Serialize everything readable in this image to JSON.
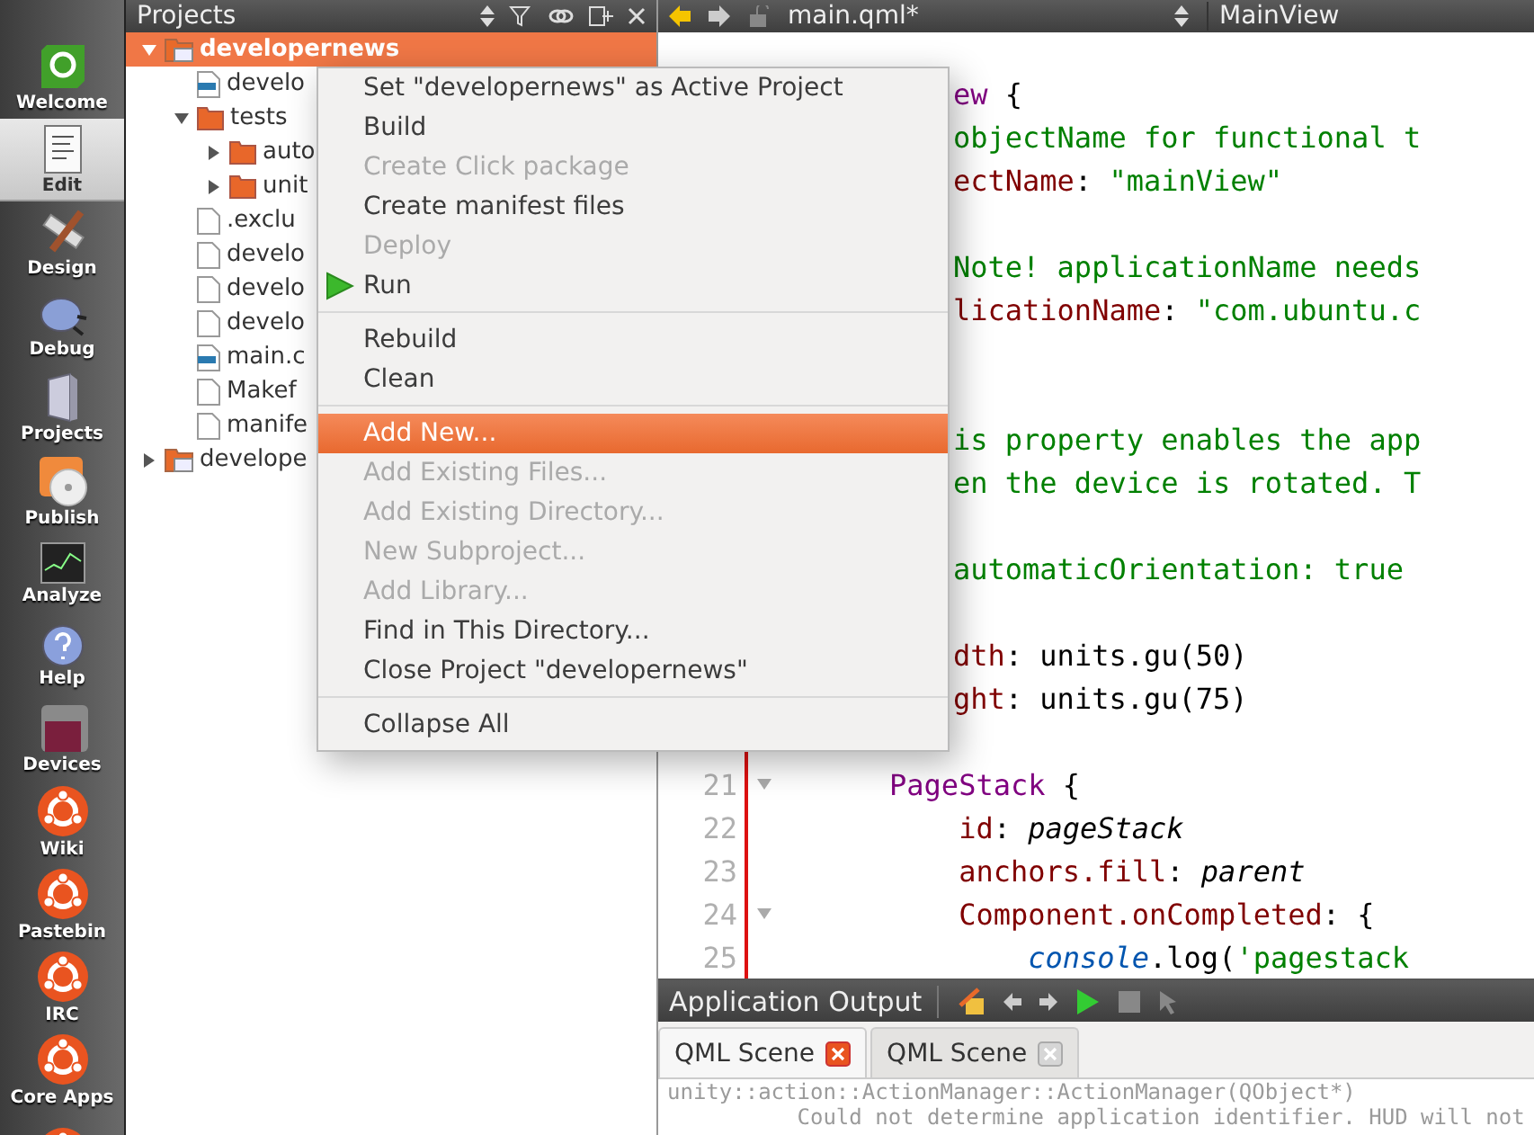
{
  "sidebar": {
    "items": [
      {
        "kind": "qt",
        "label": "Welcome",
        "selected": false
      },
      {
        "kind": "edit",
        "label": "Edit",
        "selected": true
      },
      {
        "kind": "design",
        "label": "Design",
        "selected": false
      },
      {
        "kind": "debug",
        "label": "Debug",
        "selected": false
      },
      {
        "kind": "projects",
        "label": "Projects",
        "selected": false
      },
      {
        "kind": "publish",
        "label": "Publish",
        "selected": false
      },
      {
        "kind": "analyze",
        "label": "Analyze",
        "selected": false
      },
      {
        "kind": "help",
        "label": "Help",
        "selected": false
      },
      {
        "kind": "devices",
        "label": "Devices",
        "selected": false
      },
      {
        "kind": "ubuntu",
        "label": "Wiki",
        "selected": false
      },
      {
        "kind": "ubuntu",
        "label": "Pastebin",
        "selected": false
      },
      {
        "kind": "ubuntu",
        "label": "IRC",
        "selected": false
      },
      {
        "kind": "ubuntu",
        "label": "Core Apps",
        "selected": false
      },
      {
        "kind": "ubuntu",
        "selected": false
      }
    ]
  },
  "projects_panel": {
    "title": "Projects",
    "tree": [
      {
        "kind": "project",
        "label": "developernews",
        "selected": true,
        "expanded": true,
        "children": [
          {
            "kind": "qml",
            "label": "develo",
            "selected": false
          },
          {
            "kind": "folder",
            "label": "tests",
            "selected": false,
            "expanded": true,
            "children": [
              {
                "kind": "folder",
                "label": "auto",
                "selected": false,
                "expanded": false
              },
              {
                "kind": "folder",
                "label": "unit",
                "selected": false,
                "expanded": false
              }
            ]
          },
          {
            "kind": "file",
            "label": ".exclu",
            "selected": false
          },
          {
            "kind": "file",
            "label": "develo",
            "selected": false
          },
          {
            "kind": "file",
            "label": "develo",
            "selected": false
          },
          {
            "kind": "file",
            "label": "develo",
            "selected": false
          },
          {
            "kind": "qml",
            "label": "main.c",
            "selected": false
          },
          {
            "kind": "file",
            "label": "Makef",
            "selected": false
          },
          {
            "kind": "file",
            "label": "manife",
            "selected": false
          }
        ]
      },
      {
        "kind": "project",
        "label": "develope",
        "selected": false,
        "expanded": false
      }
    ]
  },
  "editor": {
    "file": "main.qml*",
    "symbol": "MainView",
    "lines": [
      {
        "kind": "code",
        "tokens": [
          {
            "kind": "keyword",
            "text": "ew"
          },
          {
            "kind": "plain",
            "text": " {"
          }
        ]
      },
      {
        "kind": "code",
        "tokens": [
          {
            "kind": "comment",
            "text": "objectName for functional t"
          }
        ]
      },
      {
        "kind": "code",
        "tokens": [
          {
            "kind": "property",
            "text": "ectName"
          },
          {
            "kind": "plain",
            "text": ": "
          },
          {
            "kind": "string",
            "text": "\"mainView\""
          }
        ]
      },
      {
        "kind": "blank"
      },
      {
        "kind": "code",
        "tokens": [
          {
            "kind": "comment",
            "text": "Note! applicationName needs"
          }
        ]
      },
      {
        "kind": "code",
        "tokens": [
          {
            "kind": "property",
            "text": "licationName"
          },
          {
            "kind": "plain",
            "text": ": "
          },
          {
            "kind": "string",
            "text": "\"com.ubuntu.c"
          }
        ]
      },
      {
        "kind": "blank"
      },
      {
        "kind": "blank"
      },
      {
        "kind": "code",
        "tokens": [
          {
            "kind": "comment",
            "text": "is property enables the app"
          }
        ]
      },
      {
        "kind": "code",
        "tokens": [
          {
            "kind": "comment",
            "text": "en the device is rotated. T"
          }
        ]
      },
      {
        "kind": "blank"
      },
      {
        "kind": "code",
        "tokens": [
          {
            "kind": "comment",
            "text": "automaticOrientation: true"
          }
        ]
      },
      {
        "kind": "blank"
      },
      {
        "kind": "code",
        "tokens": [
          {
            "kind": "property",
            "text": "dth"
          },
          {
            "kind": "plain",
            "text": ": units.gu(50)"
          }
        ]
      },
      {
        "kind": "code",
        "tokens": [
          {
            "kind": "property",
            "text": "ght"
          },
          {
            "kind": "plain",
            "text": ": units.gu(75)"
          }
        ]
      },
      {
        "kind": "blank"
      },
      {
        "kind": "code",
        "number": "21",
        "foldable": true,
        "tokens": [
          {
            "kind": "keyword",
            "text": "    PageStack"
          },
          {
            "kind": "plain",
            "text": " {"
          }
        ]
      },
      {
        "kind": "code",
        "number": "22",
        "foldable": false,
        "tokens": [
          {
            "kind": "property",
            "text": "        id"
          },
          {
            "kind": "plain",
            "text": ": "
          },
          {
            "kind": "italic",
            "text": "pageStack"
          }
        ]
      },
      {
        "kind": "code",
        "number": "23",
        "foldable": false,
        "tokens": [
          {
            "kind": "property",
            "text": "        anchors.fill"
          },
          {
            "kind": "plain",
            "text": ": "
          },
          {
            "kind": "italic",
            "text": "parent"
          }
        ]
      },
      {
        "kind": "code",
        "number": "24",
        "foldable": true,
        "tokens": [
          {
            "kind": "property",
            "text": "        Component.onCompleted"
          },
          {
            "kind": "plain",
            "text": ": {"
          }
        ]
      },
      {
        "kind": "code",
        "number": "25",
        "foldable": false,
        "tokens": [
          {
            "kind": "builtin",
            "text": "            console"
          },
          {
            "kind": "plain",
            "text": ".log("
          },
          {
            "kind": "string",
            "text": "'pagestack"
          }
        ]
      }
    ]
  },
  "context_menu": [
    {
      "kind": "item",
      "label": "Set \"developernews\" as Active Project",
      "disabled": false,
      "selected": false
    },
    {
      "kind": "item",
      "label": "Build",
      "disabled": false,
      "selected": false
    },
    {
      "kind": "item",
      "label": "Create Click package",
      "disabled": true,
      "selected": false
    },
    {
      "kind": "item",
      "label": "Create manifest files",
      "disabled": false,
      "selected": false
    },
    {
      "kind": "item",
      "label": "Deploy",
      "disabled": true,
      "selected": false
    },
    {
      "kind": "run",
      "label": "Run",
      "disabled": false,
      "selected": false
    },
    {
      "kind": "separator"
    },
    {
      "kind": "item",
      "label": "Rebuild",
      "disabled": false,
      "selected": false
    },
    {
      "kind": "item",
      "label": "Clean",
      "disabled": false,
      "selected": false
    },
    {
      "kind": "separator"
    },
    {
      "kind": "item",
      "label": "Add New...",
      "disabled": false,
      "selected": true
    },
    {
      "kind": "item",
      "label": "Add Existing Files...",
      "disabled": true,
      "selected": false
    },
    {
      "kind": "item",
      "label": "Add Existing Directory...",
      "disabled": true,
      "selected": false
    },
    {
      "kind": "item",
      "label": "New Subproject...",
      "disabled": true,
      "selected": false
    },
    {
      "kind": "item",
      "label": "Add Library...",
      "disabled": true,
      "selected": false
    },
    {
      "kind": "item",
      "label": "Find in This Directory...",
      "disabled": false,
      "selected": false
    },
    {
      "kind": "item",
      "label": "Close Project \"developernews\"",
      "disabled": false,
      "selected": false
    },
    {
      "kind": "separator"
    },
    {
      "kind": "item",
      "label": "Collapse All",
      "disabled": false,
      "selected": false
    }
  ],
  "output": {
    "title": "Application Output",
    "tabs": [
      {
        "label": "QML Scene",
        "selected": true
      },
      {
        "label": "QML Scene",
        "selected": false
      }
    ],
    "lines": [
      "unity::action::ActionManager::ActionManager(QObject*)",
      "          Could not determine application identifier. HUD will not"
    ]
  }
}
